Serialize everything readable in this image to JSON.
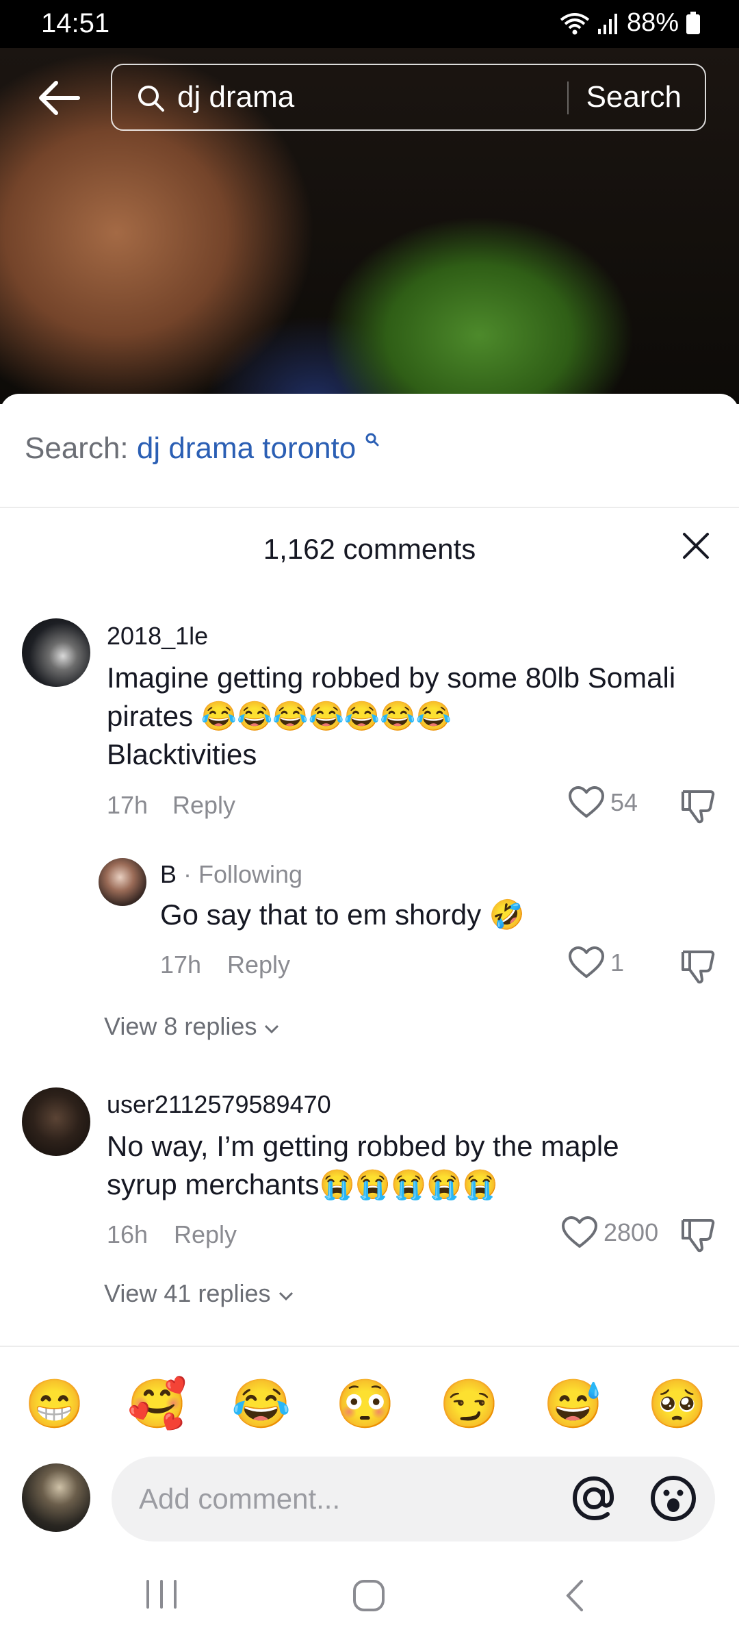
{
  "status_bar": {
    "time": "14:51",
    "battery": "88%"
  },
  "search": {
    "query": "dj drama",
    "button": "Search"
  },
  "suggestion": {
    "prefix": "Search: ",
    "term": "dj drama toronto"
  },
  "comments_count": "1,162 comments",
  "comments": [
    {
      "username": "2018_1le",
      "text_line1": "Imagine getting robbed by some 80lb Somali",
      "text_line2": "pirates 😂😂😂😂😂😂😂",
      "text_line3": "Blacktivities",
      "time": "17h",
      "reply": "Reply",
      "likes": "54"
    },
    {
      "username": "B",
      "relation": " · Following",
      "text": "Go say that to em shordy 🤣",
      "time": "17h",
      "reply": "Reply",
      "likes": "1"
    },
    {
      "username": "user2112579589470",
      "text_line1": "No way, I’m getting robbed by the maple",
      "text_line2": "syrup merchants😭😭😭😭😭",
      "time": "16h",
      "reply": "Reply",
      "likes": "2800"
    }
  ],
  "view_replies": [
    "View 8 replies",
    "View 41 replies"
  ],
  "quick_emojis": [
    "😁",
    "🥰",
    "😂",
    "😳",
    "😏",
    "😅",
    "🥺"
  ],
  "composer": {
    "placeholder": "Add comment..."
  },
  "icons": [
    "back-arrow-icon",
    "search-icon",
    "close-icon",
    "heart-icon",
    "dislike-icon",
    "chevron-down-icon",
    "at-icon",
    "emoji-icon",
    "recents-icon",
    "home-icon",
    "back-icon"
  ]
}
